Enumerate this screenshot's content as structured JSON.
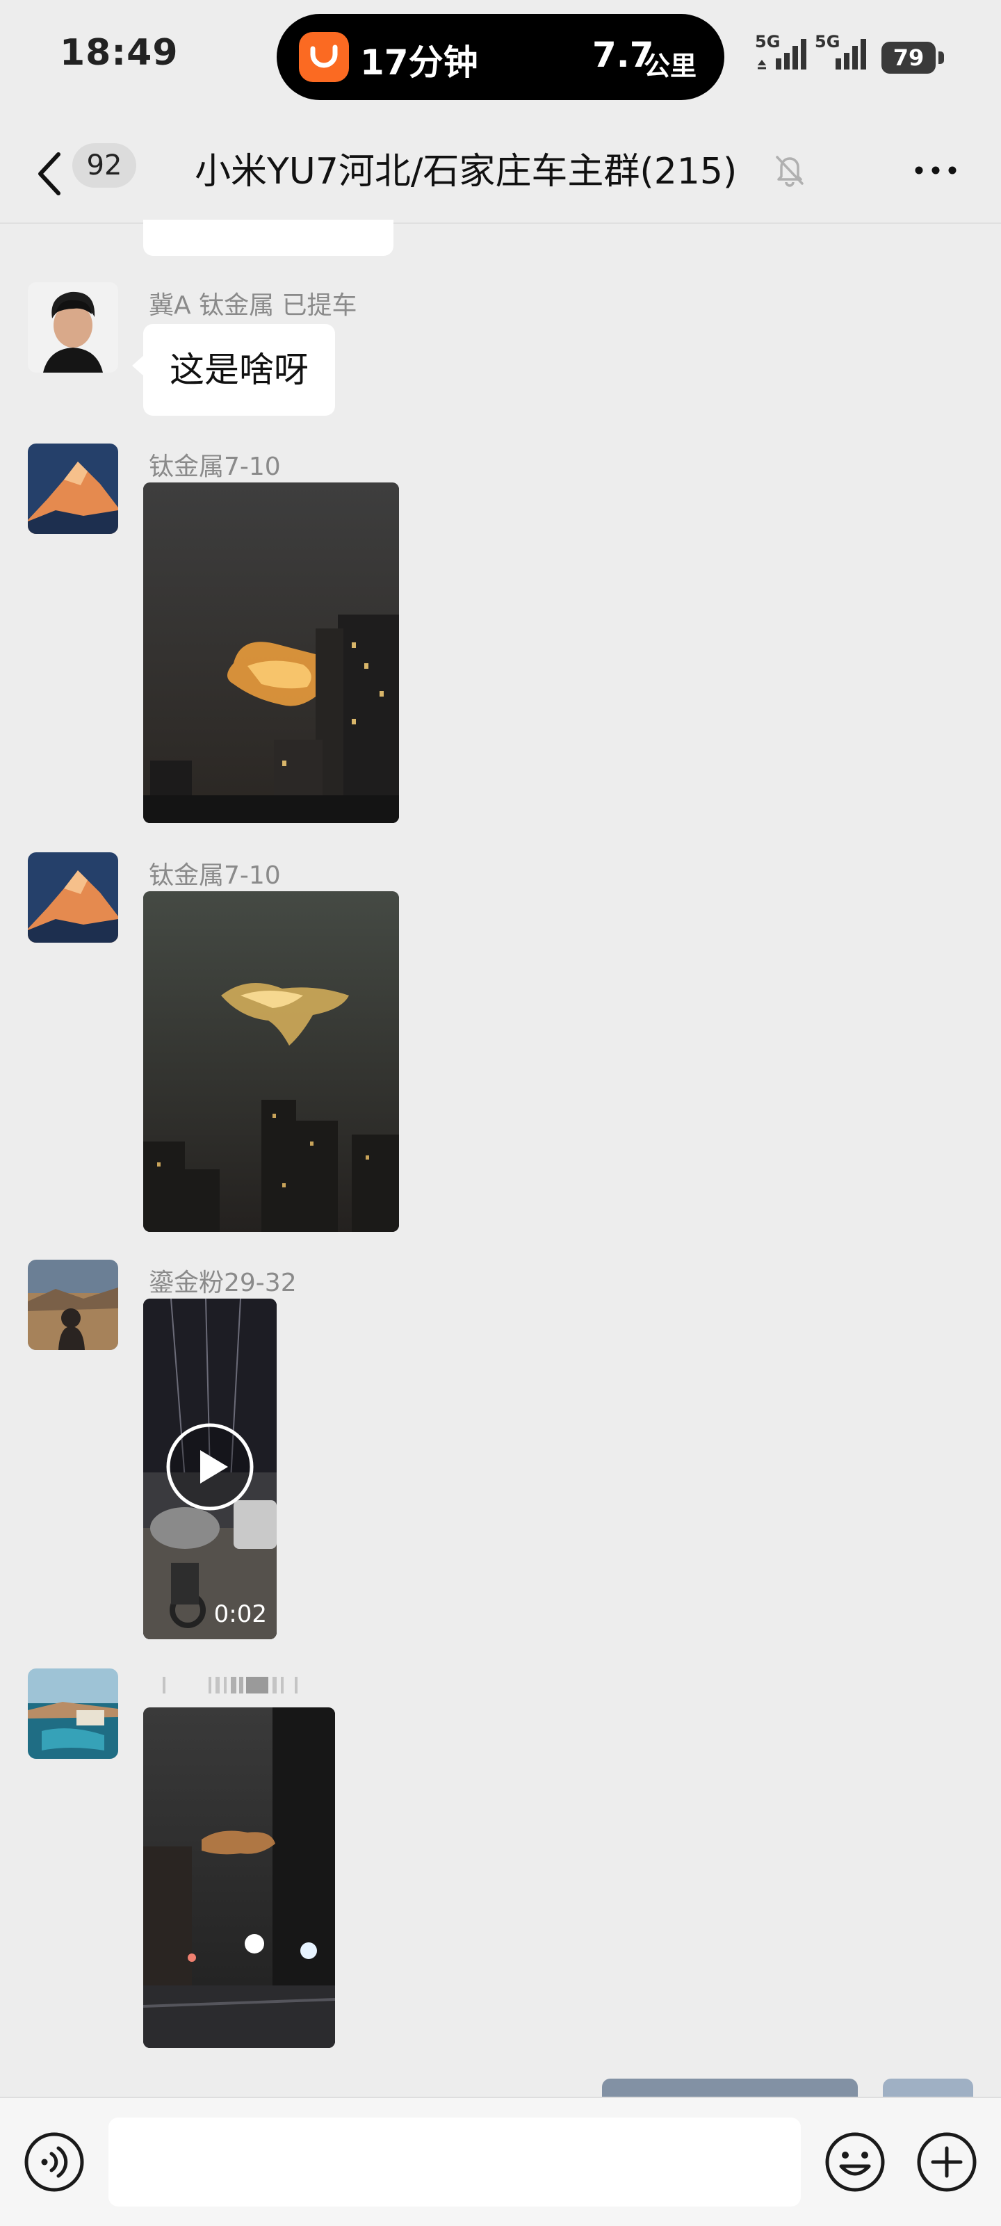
{
  "status_bar": {
    "time": "18:49",
    "island": {
      "eta": "17分钟",
      "distance": "7.7",
      "distance_unit": "公里"
    },
    "signal_1_label": "5G",
    "signal_2_label": "5G",
    "battery": "79"
  },
  "nav": {
    "back_count": "92",
    "title": "小米YU7河北/石家庄车主群(215)"
  },
  "messages": [
    {
      "sender": "冀A 钛金属 已提车",
      "text": "这是啥呀"
    },
    {
      "sender": "钛金属7-10",
      "type": "image"
    },
    {
      "sender": "钛金属7-10",
      "type": "image"
    },
    {
      "sender": "鎏金粉29-32",
      "type": "video",
      "duration": "0:02"
    },
    {
      "sender": "",
      "type": "image"
    }
  ],
  "input": {
    "placeholder": ""
  },
  "icons": {
    "back": "chevron-left-icon",
    "mute": "bell-off-icon",
    "more": "more-dots-icon",
    "voice": "voice-icon",
    "emoji": "emoji-icon",
    "plus": "plus-icon",
    "play": "play-icon"
  },
  "colors": {
    "background": "#ededed",
    "bubble": "#ffffff",
    "didi_orange": "#fb6a22"
  }
}
